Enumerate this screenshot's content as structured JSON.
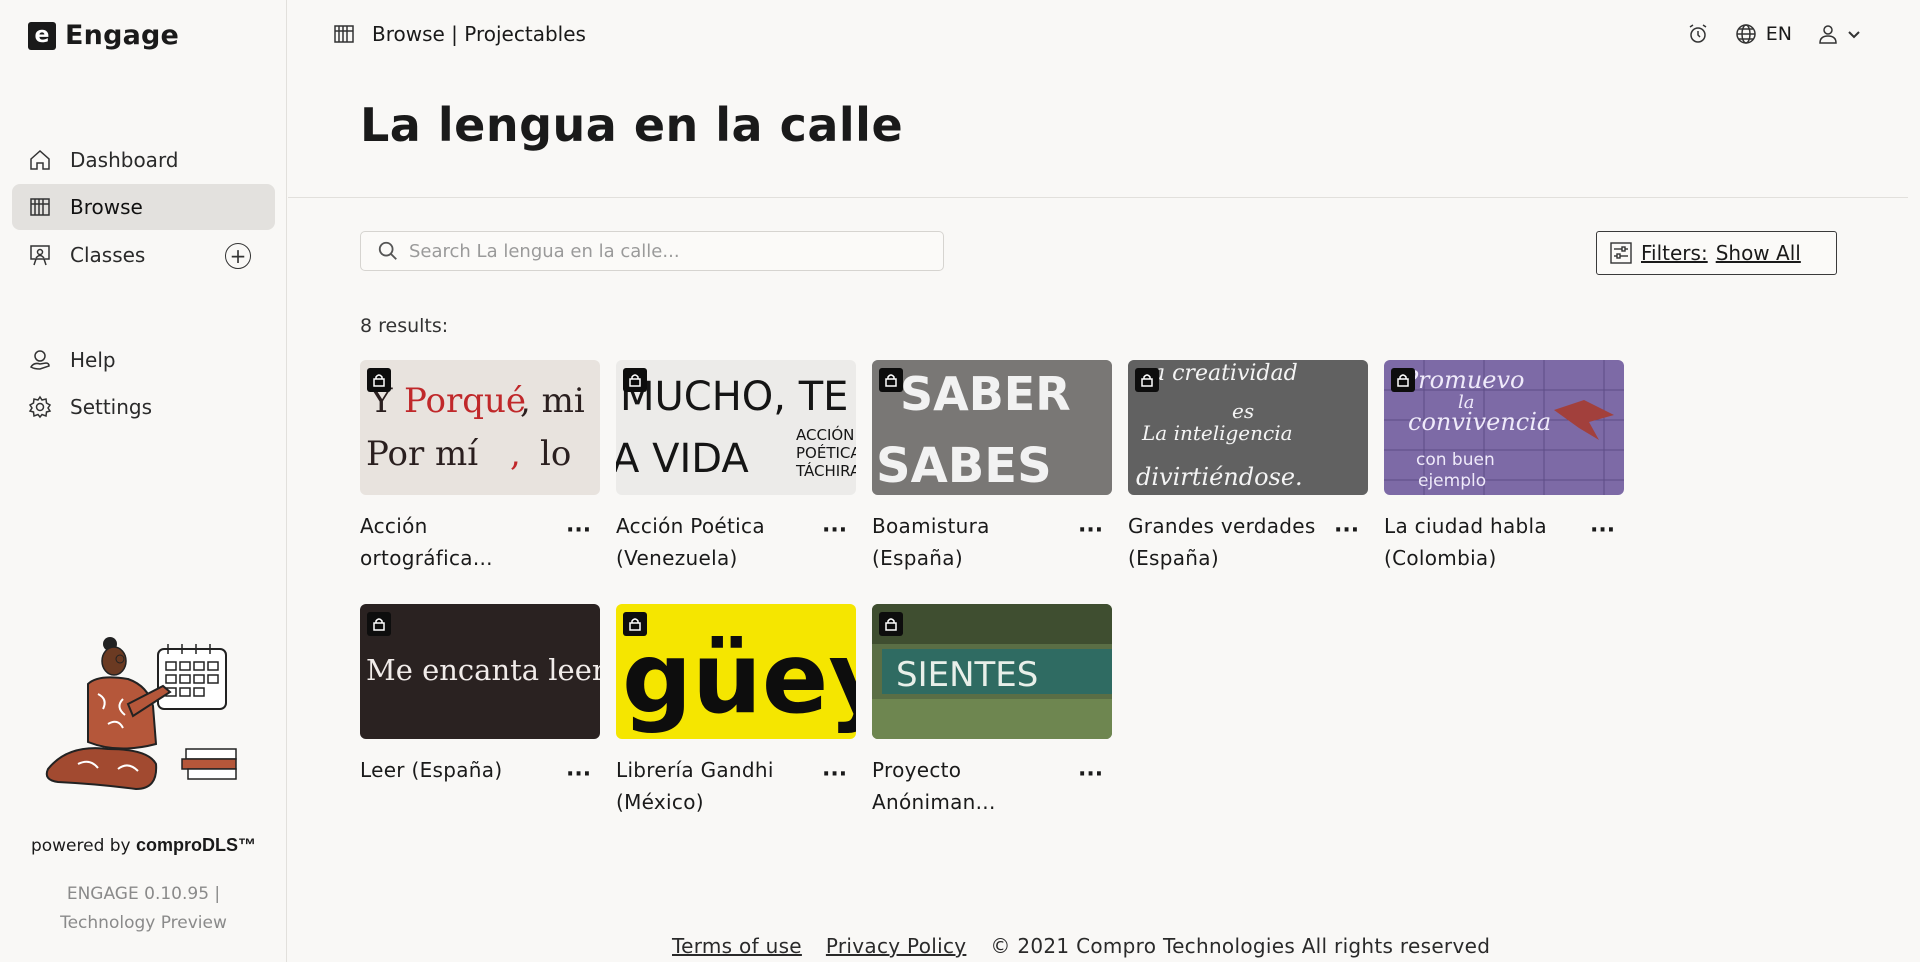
{
  "app": {
    "logo_letter": "e",
    "name": "Engage"
  },
  "sidebar": {
    "items": [
      {
        "label": "Dashboard",
        "icon": "home-icon"
      },
      {
        "label": "Browse",
        "icon": "browse-icon",
        "active": true
      },
      {
        "label": "Classes",
        "icon": "classes-icon"
      },
      {
        "label": "Help",
        "icon": "help-icon"
      },
      {
        "label": "Settings",
        "icon": "gear-icon"
      }
    ],
    "powered_prefix": "powered by ",
    "powered_brand": "comproDLS™",
    "version_line1": "ENGAGE 0.10.95 |",
    "version_line2": "Technology Preview"
  },
  "header": {
    "breadcrumb": "Browse | Projectables",
    "language": "EN"
  },
  "page": {
    "title": "La lengua en la calle",
    "search_placeholder": "Search La lengua en la calle...",
    "filters_label": "Filters:",
    "filters_value": "Show All",
    "results": "8 results:"
  },
  "cards": [
    {
      "title": "Acción ortográfica...",
      "thumb_text": "Y porqué, mi / Por mí, lo"
    },
    {
      "title": "Acción Poética (Venezuela)",
      "thumb_text": "MUCHO, TE / A VIDA"
    },
    {
      "title": "Boamistura (España)",
      "thumb_text": "SABER / SABES"
    },
    {
      "title": "Grandes verdades (España)",
      "thumb_text": "La creatividad es la inteligencia divirtiéndose."
    },
    {
      "title": "La ciudad habla (Colombia)",
      "thumb_text": "Promuevo la convivencia con buen ejemplo"
    },
    {
      "title": "Leer (España)",
      "thumb_text": "Me encanta leer."
    },
    {
      "title": "Librería Gandhi (México)",
      "thumb_text": "güey"
    },
    {
      "title": "Proyecto Anóniman...",
      "thumb_text": "SIENTES"
    }
  ],
  "footer": {
    "terms": "Terms of use",
    "privacy": "Privacy Policy",
    "copyright": "© 2021 Compro Technologies All rights reserved"
  },
  "colors": {
    "active_nav_bg": "#e3e1de",
    "text": "#1a1a1a",
    "background": "#f9f8f6"
  }
}
